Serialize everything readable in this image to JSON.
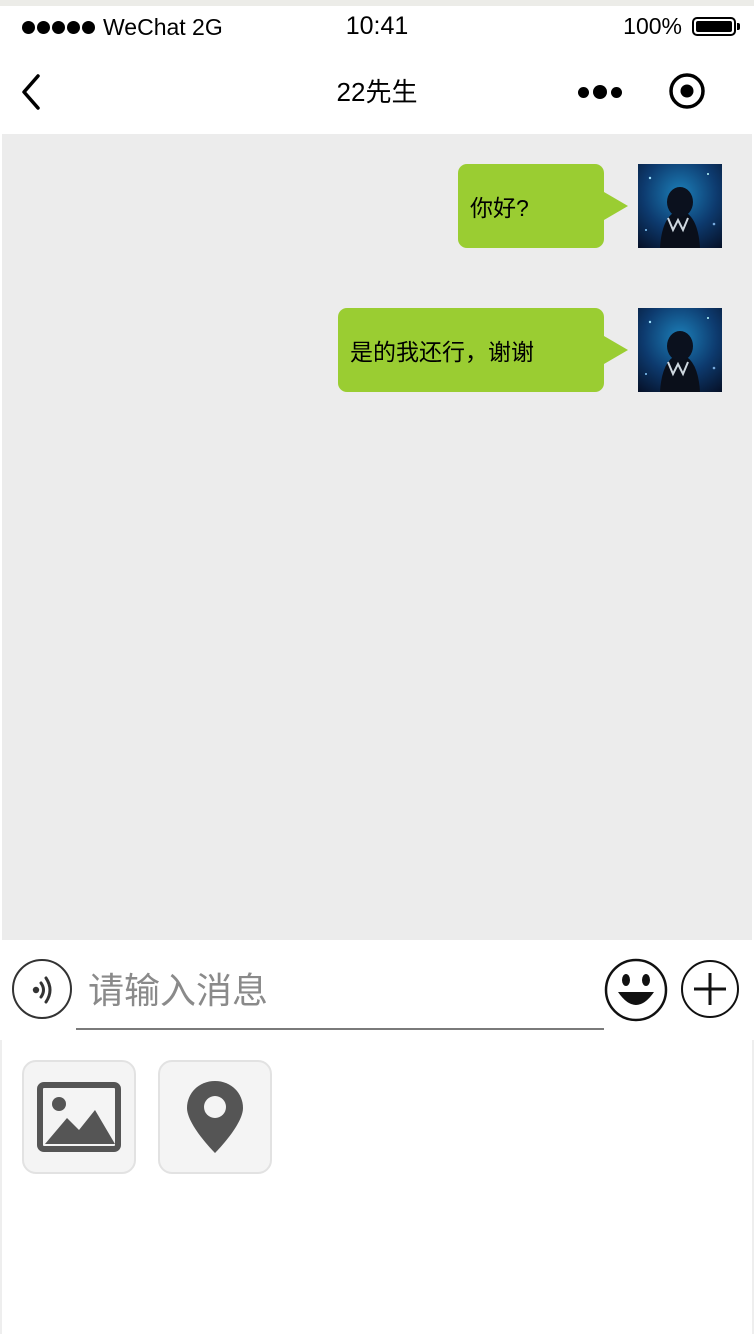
{
  "status_bar": {
    "carrier": "WeChat 2G",
    "time": "10:41",
    "battery": "100%",
    "signal_dots": 5
  },
  "nav": {
    "title": "22先生",
    "back_icon": "chevron-left-icon",
    "more_icon": "more-dots-icon",
    "target_icon": "record-target-icon"
  },
  "messages": [
    {
      "text": "你好?",
      "sender": "self"
    },
    {
      "text": "是的我还行，谢谢",
      "sender": "self"
    }
  ],
  "input": {
    "placeholder": "请输入消息",
    "value": ""
  },
  "tools": [
    {
      "name": "image",
      "icon": "image-icon"
    },
    {
      "name": "location",
      "icon": "location-pin-icon"
    }
  ],
  "colors": {
    "bubble": "#9acd32",
    "chat_background": "#ececec",
    "tool_icon": "#555555"
  }
}
